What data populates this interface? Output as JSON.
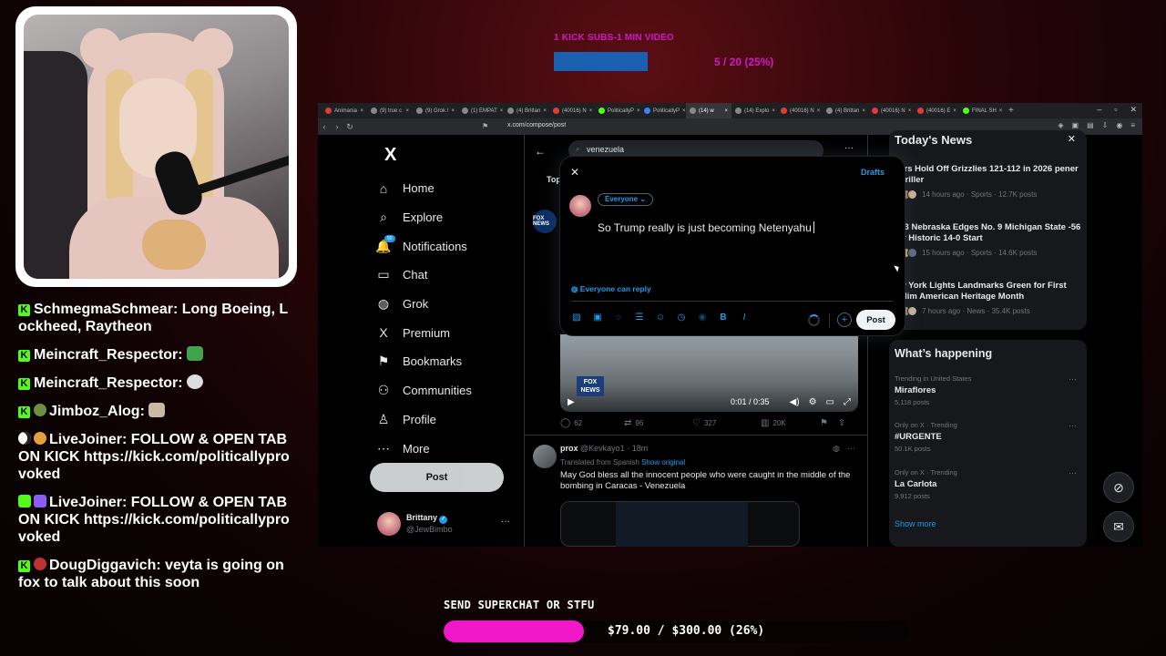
{
  "overlay": {
    "top_goal_label": "1 KICK SUBS-1 MIN VIDEO",
    "top_goal_count": "5 / 20 (25%)",
    "top_goal_progress": 0.25,
    "superchat_label": "SEND SUPERCHAT OR STFU",
    "superchat_amount": "$79.00 / $300.00 (26%)",
    "superchat_progress": 0.26,
    "accent_color": "#f018c8"
  },
  "chat": [
    {
      "text": "SchmegmaSchmear: Long Boeing, Lockheed, Raytheon",
      "cut": true,
      "badge": "kick"
    },
    {
      "text": "Meincraft_Respector:",
      "badge": "kick",
      "emote": "green"
    },
    {
      "text": "Meincraft_Respector:",
      "badge": "kick",
      "emote": "skull"
    },
    {
      "text": "Jimboz_Alog:",
      "badge": "kick+globe",
      "emote": "rock"
    },
    {
      "text": "LiveJoiner: FOLLOW & OPEN TAB ON KICK https://kick.com/politicallyprovoked",
      "badge": "moon+coin"
    },
    {
      "text": "LiveJoiner: FOLLOW & OPEN TAB ON KICK https://kick.com/politicallyprovoked",
      "badge": "play+bot"
    },
    {
      "text": "DougDiggavich: veyta is going on fox to talk about this soon",
      "badge": "kick+ball"
    }
  ],
  "browser": {
    "tabs": [
      {
        "label": "Animania",
        "color": "#e03b3b"
      },
      {
        "label": "(9) true c",
        "color": "#888"
      },
      {
        "label": "(9) Grok /",
        "color": "#888"
      },
      {
        "label": "(1) EMPAT",
        "color": "#888"
      },
      {
        "label": "(4) Brittan",
        "color": "#888"
      },
      {
        "label": "(40016) N",
        "color": "#e03b3b"
      },
      {
        "label": "PoliticallyP",
        "color": "#53fc18"
      },
      {
        "label": "PoliticallyP",
        "color": "#3b82f6"
      },
      {
        "label": "(14) w",
        "color": "#888",
        "active": true
      },
      {
        "label": "(14) Explo",
        "color": "#888"
      },
      {
        "label": "(40016) N",
        "color": "#e03b3b"
      },
      {
        "label": "(4) Brittan",
        "color": "#888"
      },
      {
        "label": "(40016) N",
        "color": "#e03b3b"
      },
      {
        "label": "(40016) E",
        "color": "#e03b3b"
      },
      {
        "label": "FINAL SH",
        "color": "#53fc18"
      }
    ],
    "url": "x.com/compose/post"
  },
  "x": {
    "nav": [
      {
        "key": "home",
        "label": "Home",
        "icon": "⌂"
      },
      {
        "key": "explore",
        "label": "Explore",
        "icon": "⌕"
      },
      {
        "key": "notifications",
        "label": "Notifications",
        "icon": "🔔",
        "badge": "50"
      },
      {
        "key": "chat",
        "label": "Chat",
        "icon": "▭"
      },
      {
        "key": "grok",
        "label": "Grok",
        "icon": "◍"
      },
      {
        "key": "premium",
        "label": "Premium",
        "icon": "X"
      },
      {
        "key": "bookmarks",
        "label": "Bookmarks",
        "icon": "⚑"
      },
      {
        "key": "communities",
        "label": "Communities",
        "icon": "⚇"
      },
      {
        "key": "profile",
        "label": "Profile",
        "icon": "♙"
      },
      {
        "key": "more",
        "label": "More",
        "icon": "⋯"
      }
    ],
    "post_button": "Post",
    "account": {
      "name": "Brittany",
      "handle": "@JewBimbo",
      "verified": true
    },
    "search_query": "venezuela",
    "tab_top": "Top",
    "fox_avatar_text": "FOX NEWS",
    "video": {
      "time": "0:01 / 0:35",
      "bug": "FOX NEWS"
    },
    "actions": {
      "replies": "62",
      "reposts": "96",
      "likes": "327",
      "views": "20K"
    },
    "post2": {
      "name": "prox",
      "handle": "@Kevkayo1 · 18m",
      "translated": "Translated from Spanish",
      "show_original": "Show original",
      "text": "May God bless all the innocent people who were caught in the middle of the bombing in Caracas - Venezuela"
    },
    "news": {
      "title": "Today's News",
      "items": [
        {
          "headline": "kers Hold Off Grizzlies 121-112 in 2026 pener Thriller",
          "meta": "14 hours ago · Sports · 12.7K posts"
        },
        {
          "headline": ". 13 Nebraska Edges No. 9 Michigan State -56 for Historic 14-0 Start",
          "meta": "15 hours ago · Sports · 14.6K posts"
        },
        {
          "headline": "ew York Lights Landmarks Green for First uslim American Heritage Month",
          "meta": "7 hours ago · News · 35.4K posts"
        }
      ]
    },
    "happening": {
      "title": "What’s happening",
      "trends": [
        {
          "context": "Trending in United States",
          "name": "Miraflores",
          "count": "5,118 posts"
        },
        {
          "context": "Only on X · Trending",
          "name": "#URGENTE",
          "count": "50.1K posts"
        },
        {
          "context": "Only on X · Trending",
          "name": "La Carlota",
          "count": "9,912 posts"
        }
      ],
      "show_more": "Show more"
    },
    "compose": {
      "drafts": "Drafts",
      "audience": "Everyone ⌄",
      "text": "So Trump really is just becoming Netenyahu",
      "reply_setting": "Everyone can reply",
      "post": "Post",
      "brand_color": "#1d9bf0"
    }
  }
}
